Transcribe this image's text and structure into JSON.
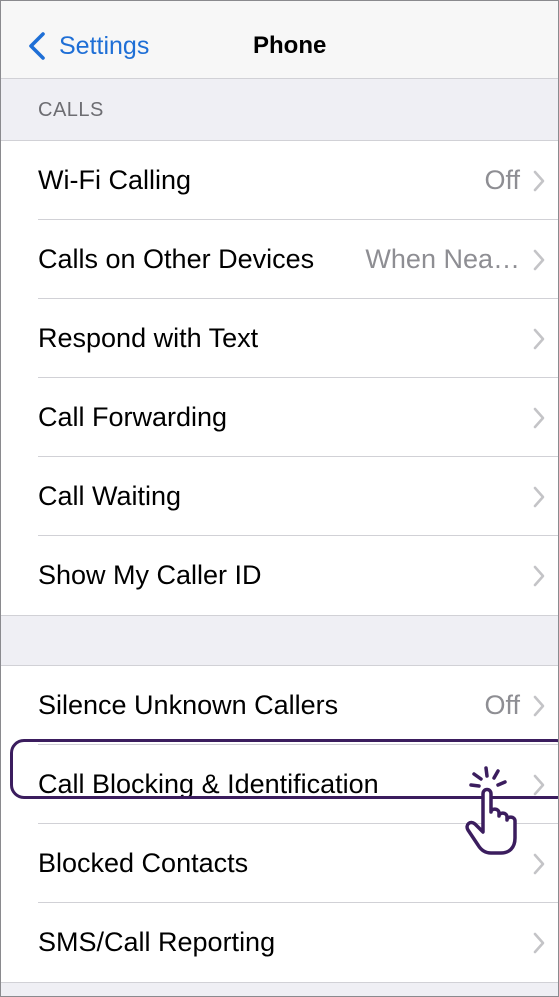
{
  "nav": {
    "back_label": "Settings",
    "title": "Phone",
    "accent_color": "#1f6fd6"
  },
  "calls_section": {
    "header": "CALLS",
    "rows": [
      {
        "label": "Wi-Fi Calling",
        "value": "Off"
      },
      {
        "label": "Calls on Other Devices",
        "value": "When Nea…"
      },
      {
        "label": "Respond with Text",
        "value": ""
      },
      {
        "label": "Call Forwarding",
        "value": ""
      },
      {
        "label": "Call Waiting",
        "value": ""
      },
      {
        "label": "Show My Caller ID",
        "value": ""
      }
    ]
  },
  "blocking_section": {
    "rows": [
      {
        "label": "Silence Unknown Callers",
        "value": "Off"
      },
      {
        "label": "Call Blocking & Identification",
        "value": ""
      },
      {
        "label": "Blocked Contacts",
        "value": ""
      },
      {
        "label": "SMS/Call Reporting",
        "value": ""
      }
    ]
  },
  "highlight": {
    "target": "Call Blocking & Identification",
    "color": "#3b1d5e",
    "cursor_icon": "tap-hand-icon"
  }
}
